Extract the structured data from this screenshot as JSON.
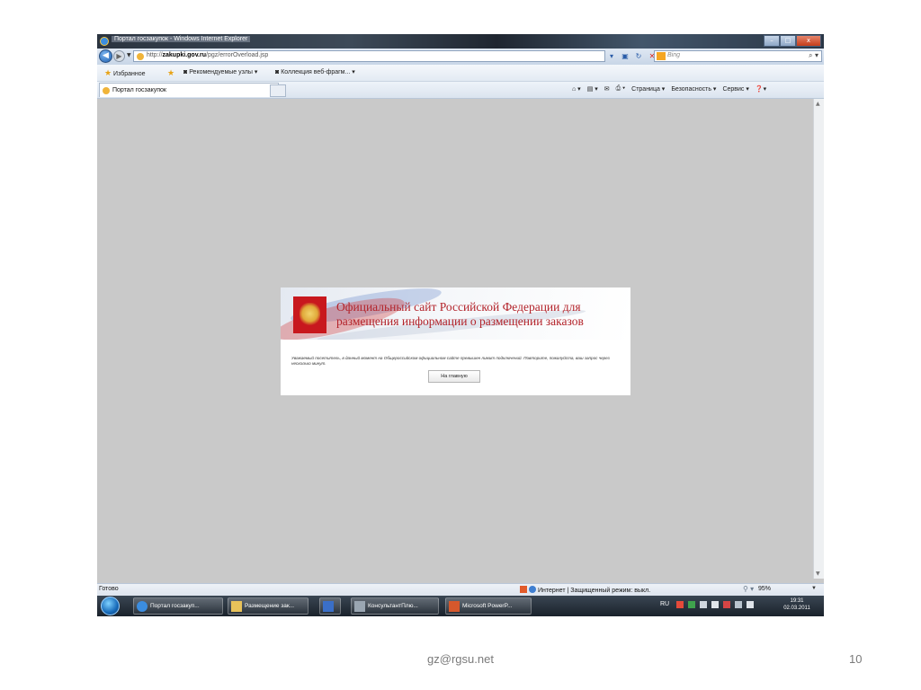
{
  "window": {
    "title": "Портал госзакупок - Windows Internet Explorer",
    "minimize": "–",
    "maximize": "□",
    "close": "x"
  },
  "address_bar": {
    "url_prefix": "http://",
    "url_domain": "zakupki.gov.ru",
    "url_path": "/pgz/errorOverload.jsp",
    "search_placeholder": "Bing"
  },
  "favorites_bar": {
    "favorites_label": "Избранное",
    "items": [
      "Рекомендуемые узлы ▾",
      "Коллекция веб-фрагм... ▾"
    ]
  },
  "tab": {
    "label": "Портал госзакупок"
  },
  "command_bar": {
    "page_menu": "Страница ▾",
    "safety_menu": "Безопасность ▾",
    "tools_menu": "Сервис ▾",
    "help_menu": "▾"
  },
  "dialog": {
    "title_line1": "Официальный сайт Российской Федерации для",
    "title_line2": "размещения информации о размещении заказов",
    "message": "Уважаемый посетитель, в данный момент на Общероссийском официальном сайте превышен лимит подключений. Повторите, пожалуйста, ваш запрос через несколько минут.",
    "home_button": "На главную"
  },
  "status_bar": {
    "status": "Готово",
    "zone": "Интернет | Защищенный режим: выкл.",
    "zoom": "95%"
  },
  "taskbar": {
    "items": [
      "Портал госзакуп...",
      "Размещение зак...",
      "",
      "КонсультантПлю...",
      "Microsoft PowerP..."
    ],
    "language": "RU",
    "time": "19:31",
    "date": "02.03.2011"
  },
  "slide": {
    "email": "gz@rgsu.net",
    "page_number": "10"
  },
  "colors": {
    "dialog_title": "#b3232a",
    "emblem_red": "#c8181e",
    "close_button": "#c43d1a"
  }
}
